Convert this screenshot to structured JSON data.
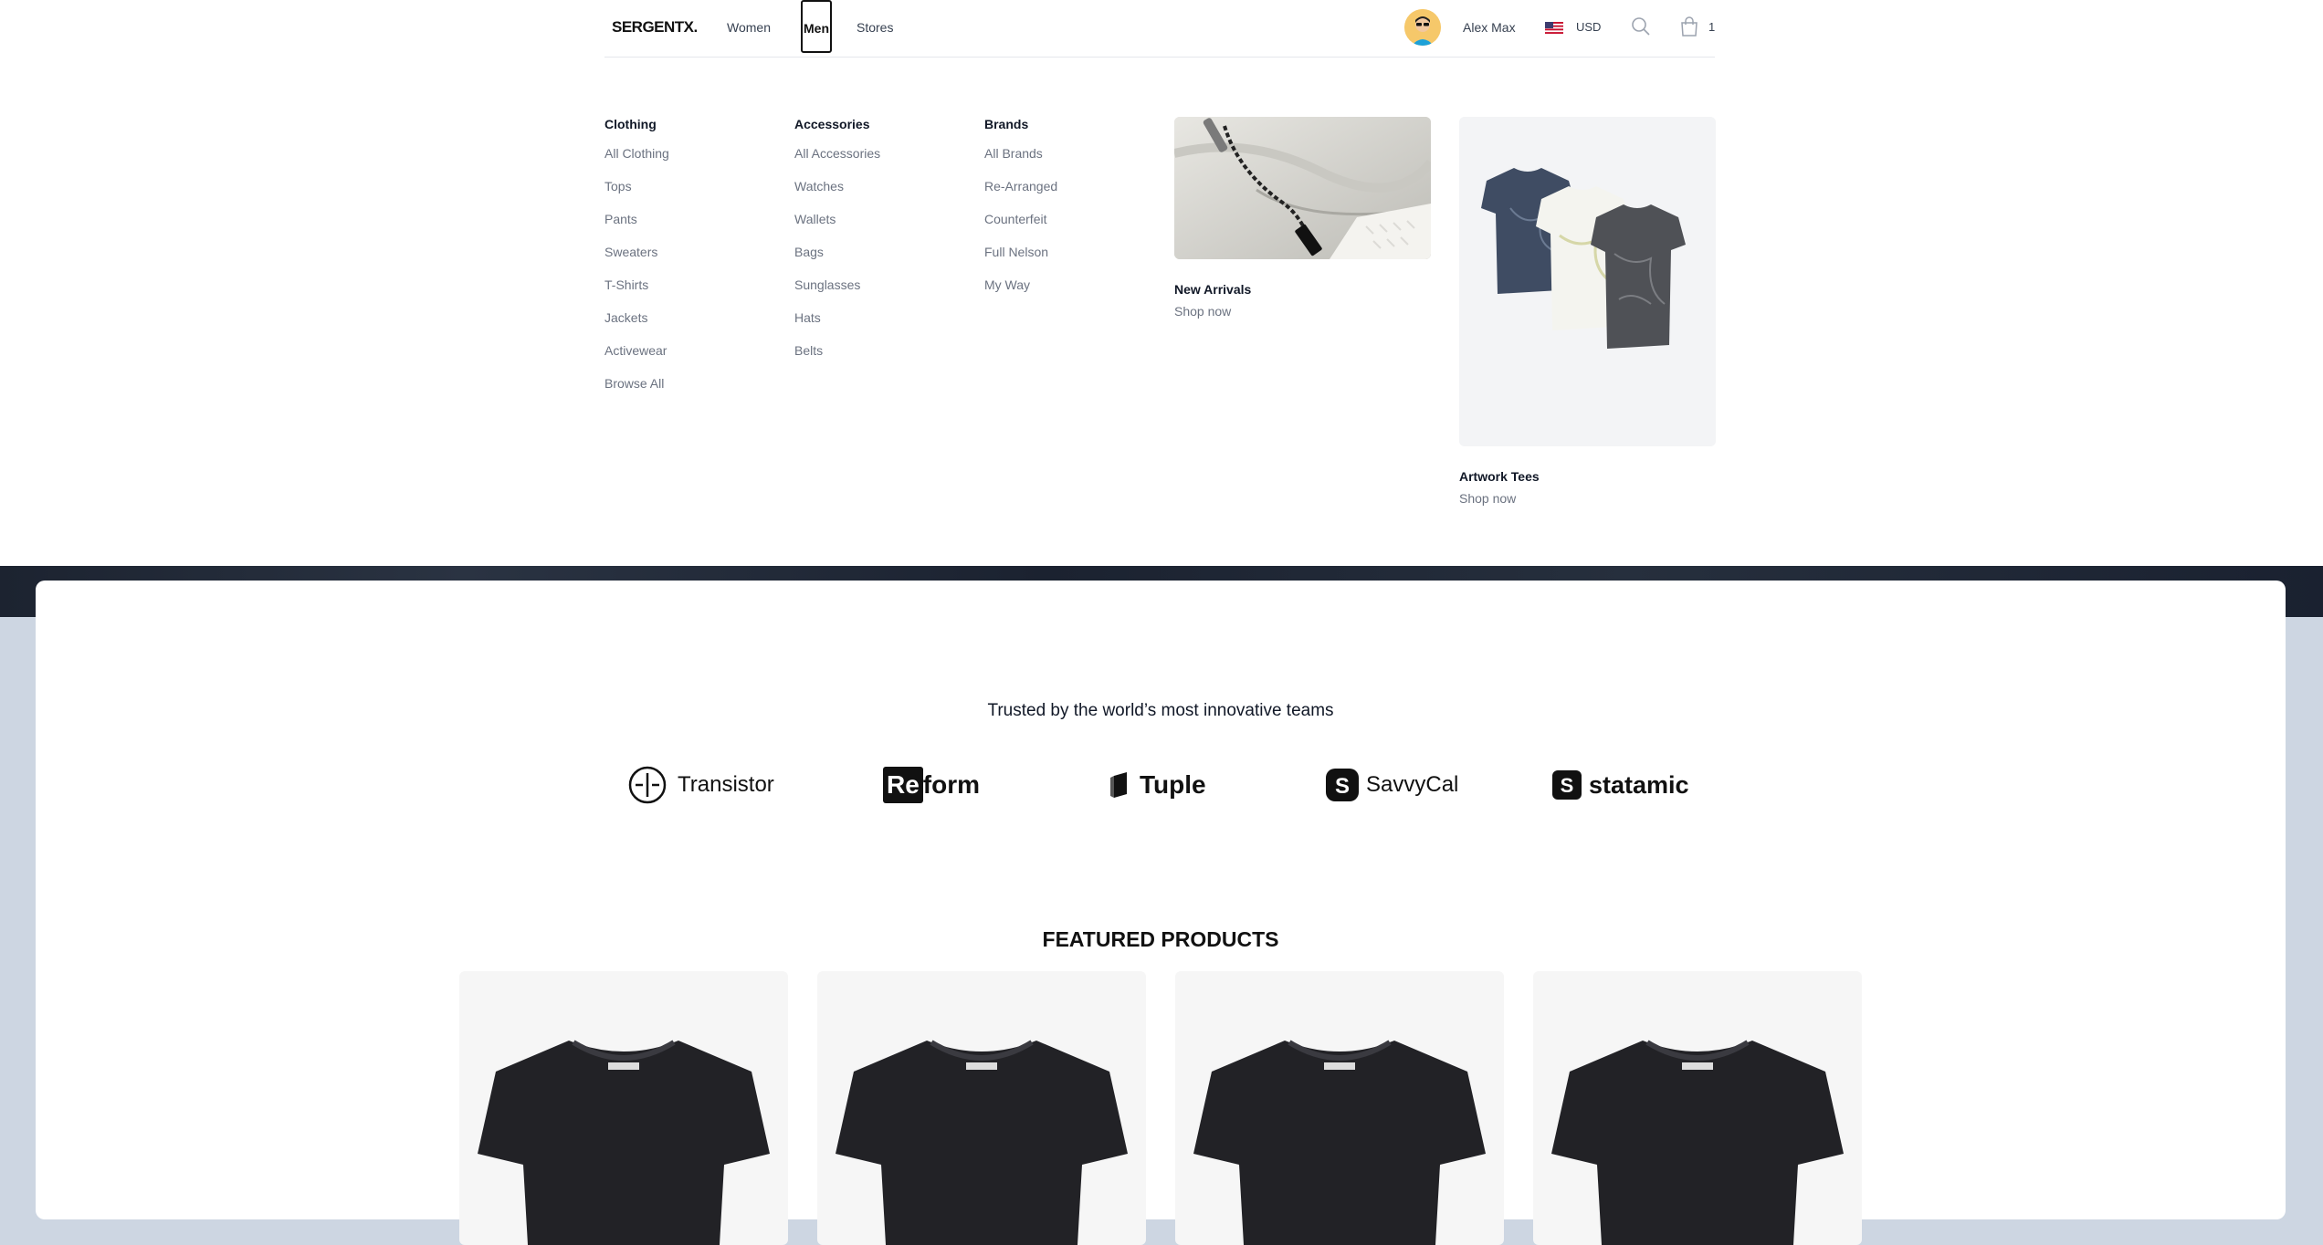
{
  "header": {
    "logo": "SERGENTX.",
    "nav": {
      "women": "Women",
      "men": "Men",
      "stores": "Stores"
    },
    "user_name": "Alex Max",
    "currency": "USD",
    "cart_count": "1"
  },
  "mega_menu": {
    "clothing": {
      "heading": "Clothing",
      "items": [
        "All Clothing",
        "Tops",
        "Pants",
        "Sweaters",
        "T-Shirts",
        "Jackets",
        "Activewear",
        "Browse All"
      ]
    },
    "accessories": {
      "heading": "Accessories",
      "items": [
        "All Accessories",
        "Watches",
        "Wallets",
        "Bags",
        "Sunglasses",
        "Hats",
        "Belts"
      ]
    },
    "brands": {
      "heading": "Brands",
      "items": [
        "All Brands",
        "Re-Arranged",
        "Counterfeit",
        "Full Nelson",
        "My Way"
      ]
    },
    "promos": [
      {
        "title": "New Arrivals",
        "cta": "Shop now"
      },
      {
        "title": "Artwork Tees",
        "cta": "Shop now"
      }
    ]
  },
  "trusted": {
    "heading": "Trusted by the world’s most innovative teams",
    "logos": [
      "Transistor",
      "Reform",
      "Tuple",
      "SavvyCal",
      "statamic"
    ]
  },
  "featured": {
    "heading": "FEATURED PRODUCTS"
  }
}
